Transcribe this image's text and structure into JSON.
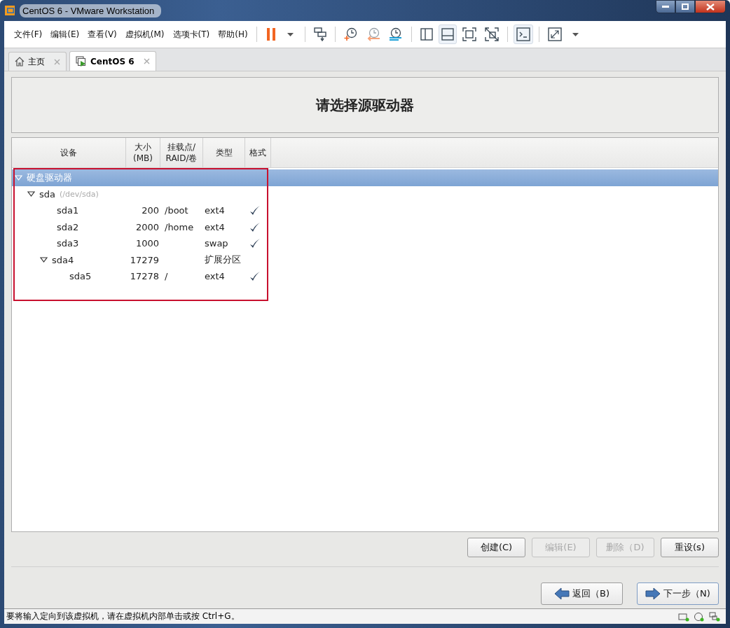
{
  "window": {
    "title": "CentOS 6 - VMware Workstation"
  },
  "menu": [
    "文件(F)",
    "编辑(E)",
    "查看(V)",
    "虚拟机(M)",
    "选项卡(T)",
    "帮助(H)"
  ],
  "toolbar": [
    {
      "kind": "pause",
      "selected": false
    },
    {
      "kind": "dropdown",
      "selected": false
    },
    {
      "kind": "sep"
    },
    {
      "kind": "send-keys",
      "selected": false
    },
    {
      "kind": "sep"
    },
    {
      "kind": "snapshot",
      "selected": false
    },
    {
      "kind": "revert",
      "selected": false
    },
    {
      "kind": "manager",
      "selected": false
    },
    {
      "kind": "sep"
    },
    {
      "kind": "sidebar",
      "selected": false
    },
    {
      "kind": "thumbbar",
      "selected": true
    },
    {
      "kind": "fullscreen",
      "selected": false
    },
    {
      "kind": "unity",
      "selected": false
    },
    {
      "kind": "sep"
    },
    {
      "kind": "console",
      "selected": true
    },
    {
      "kind": "sep"
    },
    {
      "kind": "stretch",
      "selected": false
    },
    {
      "kind": "dropdown",
      "selected": false
    }
  ],
  "tabs": [
    {
      "label": "主页",
      "kind": "home",
      "selected": false
    },
    {
      "label": "CentOS 6",
      "kind": "vm",
      "selected": true
    }
  ],
  "installer": {
    "heading": "请选择源驱动器",
    "columns": [
      "设备",
      "大小\n(MB)",
      "挂载点/\nRAID/卷",
      "类型",
      "格式"
    ],
    "tree": [
      {
        "device": "硬盘驱动器",
        "selected": true,
        "expanded": true,
        "children": [
          {
            "device": "sda",
            "detail": "(/dev/sda)",
            "selected": false,
            "expanded": true,
            "children": [
              {
                "device": "sda1",
                "size": "200",
                "mount": "/boot",
                "type": "ext4",
                "format": true,
                "selected": false
              },
              {
                "device": "sda2",
                "size": "2000",
                "mount": "/home",
                "type": "ext4",
                "format": true,
                "selected": false
              },
              {
                "device": "sda3",
                "size": "1000",
                "type": "swap",
                "format": true,
                "selected": false
              },
              {
                "device": "sda4",
                "size": "17279",
                "type": "扩展分区",
                "format": false,
                "selected": false,
                "expanded": true,
                "children": [
                  {
                    "device": "sda5",
                    "size": "17278",
                    "mount": "/",
                    "type": "ext4",
                    "format": true,
                    "selected": false
                  }
                ]
              }
            ]
          }
        ]
      }
    ],
    "actions": [
      {
        "label": "创建(C)",
        "disabled": false
      },
      {
        "label": "编辑(E)",
        "disabled": true
      },
      {
        "label": "删除（D)",
        "disabled": true
      },
      {
        "label": "重设(s)",
        "disabled": false
      }
    ],
    "nav": [
      {
        "label": "返回（B)",
        "kind": "back"
      },
      {
        "label": "下一步（N)",
        "kind": "next"
      }
    ]
  },
  "status_bar": {
    "message": "要将输入定向到该虚拟机，请在虚拟机内部单击或按 Ctrl+G。"
  }
}
